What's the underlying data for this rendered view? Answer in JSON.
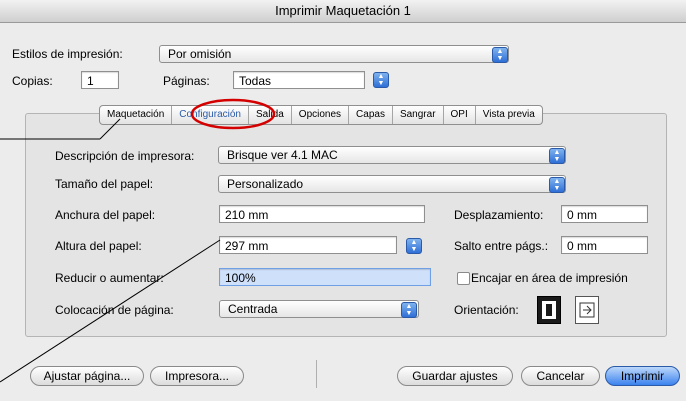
{
  "window": {
    "title": "Imprimir Maquetación 1"
  },
  "top": {
    "estilos_label": "Estilos de impresión:",
    "estilos_value": "Por omisión",
    "copias_label": "Copias:",
    "copias_value": "1",
    "paginas_label": "Páginas:",
    "paginas_value": "Todas"
  },
  "tabs": [
    "Maquetación",
    "Configuración",
    "Salida",
    "Opciones",
    "Capas",
    "Sangrar",
    "OPI",
    "Vista previa"
  ],
  "settings": {
    "descripcion_label": "Descripción de impresora:",
    "descripcion_value": "Brisque ver 4.1 MAC",
    "tamano_label": "Tamaño del papel:",
    "tamano_value": "Personalizado",
    "anchura_label": "Anchura del papel:",
    "anchura_value": "210 mm",
    "altura_label": "Altura del papel:",
    "altura_value": "297 mm",
    "reducir_label": "Reducir o aumentar:",
    "reducir_value": "100%",
    "colocacion_label": "Colocación de página:",
    "colocacion_value": "Centrada",
    "desplazamiento_label": "Desplazamiento:",
    "desplazamiento_value": "0 mm",
    "salto_label": "Salto entre págs.:",
    "salto_value": "0 mm",
    "encajar_label": "Encajar en área de impresión",
    "orientacion_label": "Orientación:"
  },
  "buttons": {
    "ajustar": "Ajustar página...",
    "impresora": "Impresora...",
    "guardar": "Guardar ajustes",
    "cancelar": "Cancelar",
    "imprimir": "Imprimir"
  },
  "colors": {
    "accent": "#3b82ee",
    "annotation": "#d40000"
  }
}
